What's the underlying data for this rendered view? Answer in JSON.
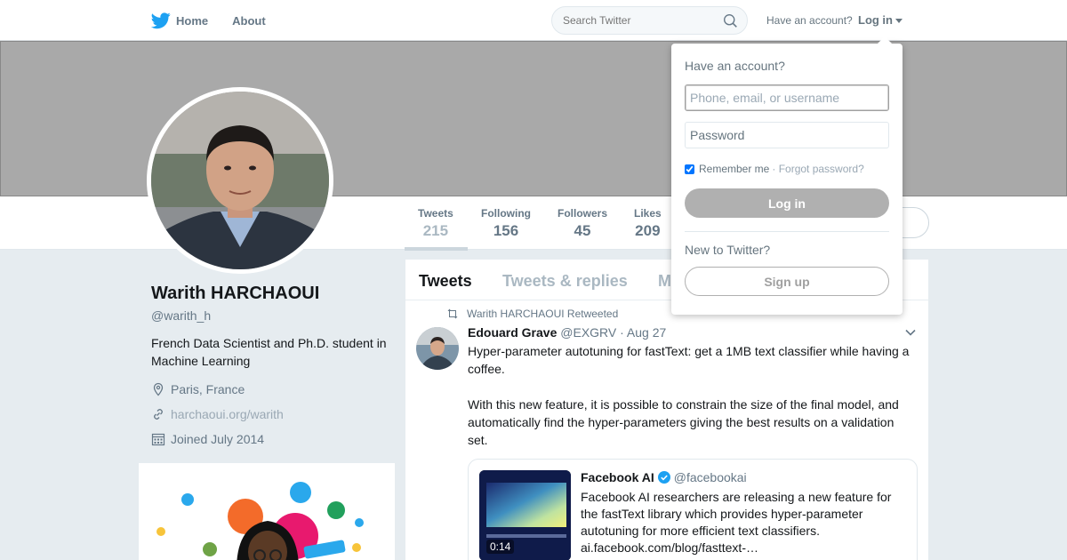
{
  "nav": {
    "home_label": "Home",
    "about_label": "About",
    "search_placeholder": "Search Twitter",
    "have_account": "Have an account?",
    "login_label": "Log in"
  },
  "profile": {
    "name": "Warith HARCHAOUI",
    "handle": "@warith_h",
    "bio": "French Data Scientist and Ph.D. student in Machine Learning",
    "location": "Paris, France",
    "website": "harchaoui.org/warith",
    "joined": "Joined July 2014"
  },
  "stats": [
    {
      "label": "Tweets",
      "value": "215"
    },
    {
      "label": "Following",
      "value": "156"
    },
    {
      "label": "Followers",
      "value": "45"
    },
    {
      "label": "Likes",
      "value": "209"
    }
  ],
  "tabs": [
    "Tweets",
    "Tweets & replies",
    "M"
  ],
  "tweet": {
    "retweet_line": "Warith HARCHAOUI Retweeted",
    "author_name": "Edouard Grave",
    "author_handle": "@EXGRV",
    "date": "· Aug 27",
    "text_p1": "Hyper-parameter autotuning for fastText: get a 1MB text classifier while having a coffee.",
    "text_p2": "With this new feature, it is possible to constrain the size of the final model, and automatically find the hyper-parameters giving the best results on a validation set."
  },
  "quote": {
    "name": "Facebook AI",
    "handle": "@facebookai",
    "text": "Facebook AI researchers are releasing a new feature for the fastText library which provides hyper-parameter autotuning for more efficient text classifiers. ai.facebook.com/blog/fasttext-…",
    "duration": "0:14"
  },
  "login_dropdown": {
    "title": "Have an account?",
    "username_placeholder": "Phone, email, or username",
    "password_placeholder": "Password",
    "remember_label": "Remember me",
    "forgot_label": "· Forgot password?",
    "login_button": "Log in",
    "new_label": "New to Twitter?",
    "signup_button": "Sign up"
  },
  "colors": {
    "brand": "#1da1f2",
    "banner": "#a9a9a9",
    "background": "#e6ecf0"
  }
}
